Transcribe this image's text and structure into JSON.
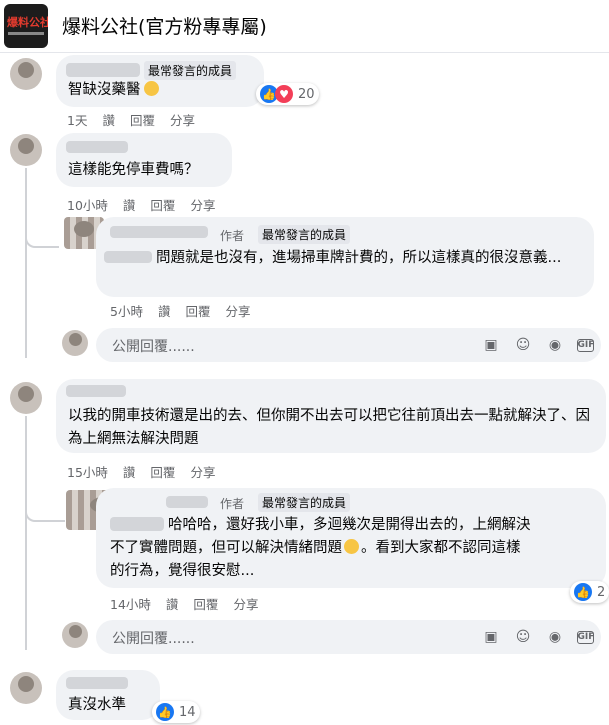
{
  "header": {
    "page_name": "爆料公社(官方粉專專屬)",
    "logo_text": "爆料公社"
  },
  "comments": [
    {
      "badge": "最常發言的成員",
      "text": "智缺沒藥醫",
      "reaction_count": "20",
      "time": "1天",
      "read": "讚",
      "reply": "回覆",
      "share": "分享"
    },
    {
      "text": "這樣能免停車費嗎？",
      "time": "10小時",
      "read": "讚",
      "reply": "回覆",
      "share": "分享"
    },
    {
      "author_tag": "作者",
      "badge": "最常發言的成員",
      "text": "問題就是也沒有，進場掃車牌計費的，所以這樣真的很沒意義...",
      "time": "5小時",
      "read": "讚",
      "reply": "回覆",
      "share": "分享"
    },
    {
      "text": "以我的開車技術還是出的去、但你開不出去可以把它往前頂出去一點就解決了、因為上網無法解決問題",
      "time": "15小時",
      "read": "讚",
      "reply": "回覆",
      "share": "分享"
    },
    {
      "author_tag": "作者",
      "badge": "最常發言的成員",
      "text_lines": [
        "哈哈哈，還好我小車，多迴幾次是開得出去的，上網解決",
        "不了實體問題，但可以解決情緒問題",
        "。看到大家都不認同這樣",
        "的行為，覺得很安慰..."
      ],
      "reaction_count": "2",
      "time": "14小時",
      "read": "讚",
      "reply": "回覆",
      "share": "分享"
    },
    {
      "text": "真沒水準",
      "reaction_count": "14"
    }
  ],
  "reply_placeholder": "公開回覆......"
}
